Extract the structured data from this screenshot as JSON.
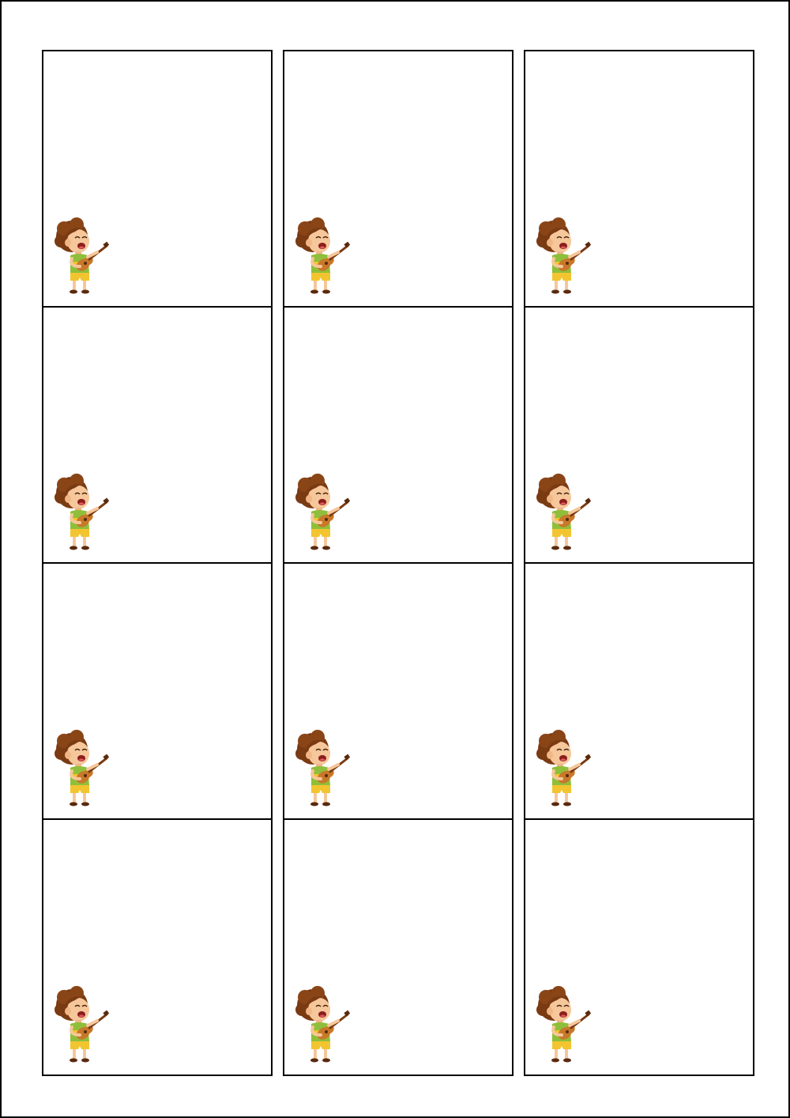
{
  "sheet": {
    "columns": 3,
    "rows": 4,
    "card_illustration": "boy-playing-ukulele-icon",
    "colors": {
      "border": "#000000",
      "background": "#ffffff",
      "hair": "#7a3a12",
      "skin": "#f6c79a",
      "shirt": "#8fbf3a",
      "shorts": "#f2c530",
      "ukulele": "#c8782a"
    }
  }
}
